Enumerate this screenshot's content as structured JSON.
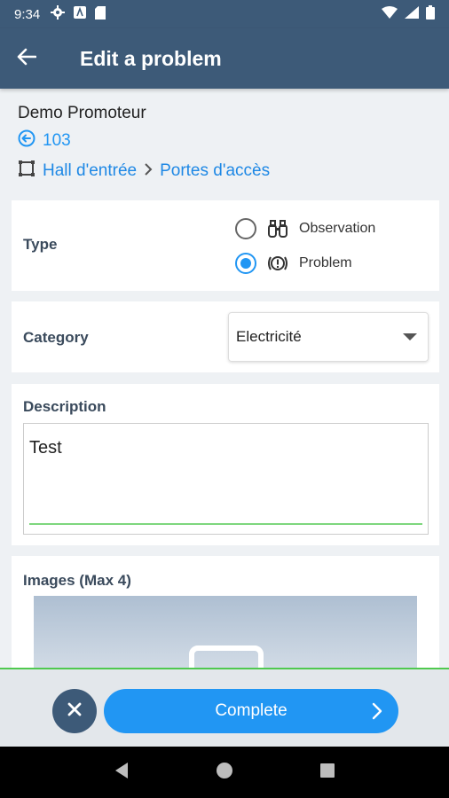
{
  "status_bar": {
    "time": "9:34"
  },
  "app_bar": {
    "title": "Edit a problem"
  },
  "header": {
    "organization": "Demo Promoteur",
    "reference": "103",
    "location": [
      "Hall d'entrée",
      "Portes d'accès"
    ]
  },
  "type": {
    "label": "Type",
    "options": [
      {
        "label": "Observation",
        "icon": "binoculars-icon",
        "selected": false
      },
      {
        "label": "Problem",
        "icon": "alert-icon",
        "selected": true
      }
    ]
  },
  "category": {
    "label": "Category",
    "value": "Electricité"
  },
  "description": {
    "label": "Description",
    "value": "Test"
  },
  "images": {
    "label": "Images (Max 4)"
  },
  "actions": {
    "complete_label": "Complete"
  },
  "colors": {
    "primary": "#2196f3",
    "app_bar": "#3d5a78",
    "accent_line": "#4fc94f"
  }
}
